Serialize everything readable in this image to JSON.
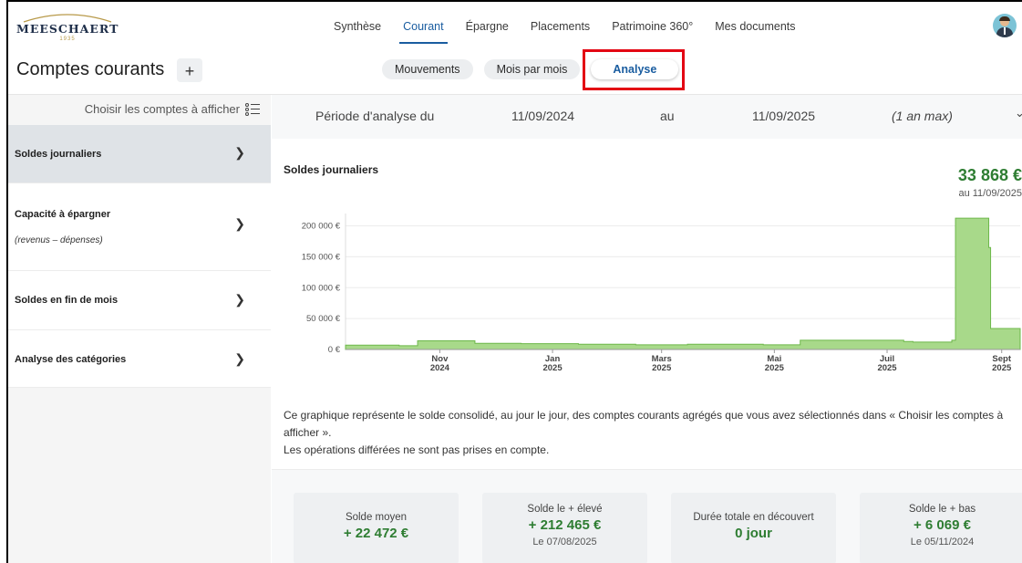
{
  "brand": {
    "name": "MEESCHAERT",
    "year": "1935"
  },
  "nav": {
    "items": [
      "Synthèse",
      "Courant",
      "Épargne",
      "Placements",
      "Patrimoine 360°",
      "Mes documents"
    ],
    "active_index": 1
  },
  "page": {
    "title": "Comptes courants",
    "add_label": "+"
  },
  "segments": {
    "items": [
      "Mouvements",
      "Mois par mois",
      "Analyse"
    ],
    "active_index": 2
  },
  "sidebar": {
    "choose_label": "Choisir les comptes à afficher",
    "items": [
      {
        "label": "Soldes journaliers",
        "sub": ""
      },
      {
        "label": "Capacité à épargner",
        "sub": "(revenus – dépenses)"
      },
      {
        "label": "Soldes en fin de mois",
        "sub": ""
      },
      {
        "label": "Analyse des catégories",
        "sub": ""
      }
    ],
    "active_index": 0
  },
  "period": {
    "label": "Période d'analyse du",
    "start": "11/09/2024",
    "sep": "au",
    "end": "11/09/2025",
    "note": "(1 an max)"
  },
  "chart_header": {
    "title": "Soldes journaliers",
    "amount": "33 868 €",
    "date": "au 11/09/2025"
  },
  "chart_data": {
    "type": "area",
    "x": [
      "2024-09-11",
      "2024-10-10",
      "2024-10-20",
      "2024-11-08",
      "2024-11-20",
      "2024-12-15",
      "2025-01-15",
      "2025-02-15",
      "2025-03-15",
      "2025-04-15",
      "2025-04-25",
      "2025-05-15",
      "2025-06-15",
      "2025-07-10",
      "2025-07-15",
      "2025-08-05",
      "2025-08-07",
      "2025-08-12",
      "2025-08-25",
      "2025-08-26",
      "2025-09-11"
    ],
    "y": [
      7000,
      6069,
      14000,
      14000,
      10000,
      9500,
      8500,
      7500,
      8500,
      8500,
      7500,
      15000,
      15000,
      13000,
      12000,
      15000,
      212465,
      212465,
      165000,
      33868,
      33868
    ],
    "yticks": [
      "0 €",
      "50 000 €",
      "100 000 €",
      "150 000 €",
      "200 000 €"
    ],
    "xticks": [
      {
        "month": "Nov",
        "year": "2024"
      },
      {
        "month": "Jan",
        "year": "2025"
      },
      {
        "month": "Mars",
        "year": "2025"
      },
      {
        "month": "Mai",
        "year": "2025"
      },
      {
        "month": "Juil",
        "year": "2025"
      },
      {
        "month": "Sept",
        "year": "2025"
      }
    ],
    "ylim": [
      0,
      220000
    ],
    "color": "#a8d98a",
    "line_color": "#6db84a"
  },
  "description": {
    "line1": "Ce graphique représente le solde consolidé, au jour le jour, des comptes courants agrégés que vous avez sélectionnés dans « Choisir les comptes à afficher ».",
    "line2": "Les opérations différées ne sont pas prises en compte."
  },
  "stats": [
    {
      "label": "Solde moyen",
      "value": "+ 22 472 €",
      "date": ""
    },
    {
      "label": "Solde le + élevé",
      "value": "+ 212 465 €",
      "date": "Le 07/08/2025"
    },
    {
      "label": "Durée totale en découvert",
      "value": "0 jour",
      "date": ""
    },
    {
      "label": "Solde le + bas",
      "value": "+ 6 069 €",
      "date": "Le 05/11/2024"
    }
  ]
}
